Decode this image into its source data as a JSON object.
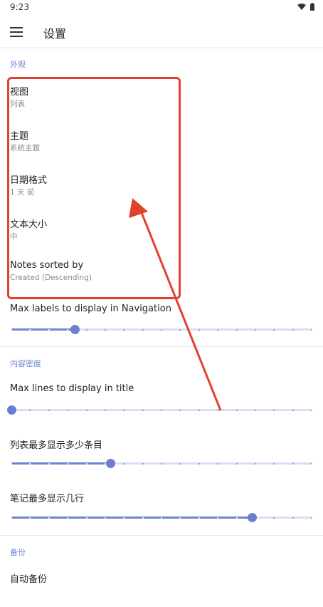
{
  "status_bar": {
    "time": "9:23"
  },
  "app_bar": {
    "title": "设置"
  },
  "sections": {
    "appearance": "外观",
    "density": "内容密度",
    "backup": "备份"
  },
  "appearance_items": [
    {
      "title": "视图",
      "summary": "列表"
    },
    {
      "title": "主题",
      "summary": "系统主题"
    },
    {
      "title": "日期格式",
      "summary": "1 天 前"
    },
    {
      "title": "文本大小",
      "summary": "中"
    },
    {
      "title": "Notes sorted by",
      "summary": "Created (Descending)"
    }
  ],
  "sliders": {
    "max_labels": {
      "title": "Max labels to display in Navigation",
      "level": 0.21
    },
    "max_lines_title": {
      "title": "Max lines to display in title",
      "level": 0.0
    },
    "list_items": {
      "title": "列表最多显示多少条目",
      "level": 0.33
    },
    "note_lines": {
      "title": "笔记最多显示几行",
      "level": 0.8
    }
  },
  "backup_items": [
    {
      "title": "自动备份"
    }
  ],
  "colors": {
    "accent": "#6f84cf",
    "annotation": "#e2402f",
    "section_header": "#6f86d6"
  }
}
